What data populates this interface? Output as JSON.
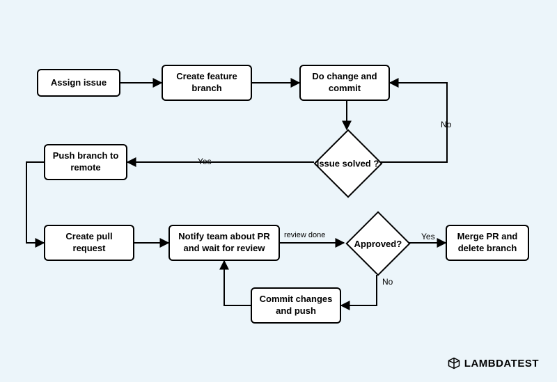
{
  "nodes": {
    "assign": "Assign issue",
    "create_branch": "Create feature branch",
    "do_change": "Do change and commit",
    "issue_solved": "Issue solved ?",
    "push": "Push branch to remote",
    "create_pr": "Create pull request",
    "notify": "Notify team about PR and wait for review",
    "approved": "Approved?",
    "merge": "Merge PR and delete branch",
    "commit_push": "Commit changes and push"
  },
  "edges": {
    "no1": "No",
    "yes1": "Yes",
    "review_done": "review done",
    "yes2": "Yes",
    "no2": "No"
  },
  "brand": "LAMBDATEST",
  "chart_data": {
    "type": "flowchart",
    "nodes": [
      {
        "id": "assign",
        "label": "Assign issue",
        "shape": "rect"
      },
      {
        "id": "create_branch",
        "label": "Create feature branch",
        "shape": "rect"
      },
      {
        "id": "do_change",
        "label": "Do change and commit",
        "shape": "rect"
      },
      {
        "id": "issue_solved",
        "label": "Issue solved ?",
        "shape": "diamond"
      },
      {
        "id": "push",
        "label": "Push branch to remote",
        "shape": "rect"
      },
      {
        "id": "create_pr",
        "label": "Create pull request",
        "shape": "rect"
      },
      {
        "id": "notify",
        "label": "Notify team about PR and wait for review",
        "shape": "rect"
      },
      {
        "id": "approved",
        "label": "Approved?",
        "shape": "diamond"
      },
      {
        "id": "merge",
        "label": "Merge PR and delete branch",
        "shape": "rect"
      },
      {
        "id": "commit_push",
        "label": "Commit changes and push",
        "shape": "rect"
      }
    ],
    "edges": [
      {
        "from": "assign",
        "to": "create_branch"
      },
      {
        "from": "create_branch",
        "to": "do_change"
      },
      {
        "from": "do_change",
        "to": "issue_solved"
      },
      {
        "from": "issue_solved",
        "to": "do_change",
        "label": "No"
      },
      {
        "from": "issue_solved",
        "to": "push",
        "label": "Yes"
      },
      {
        "from": "push",
        "to": "create_pr"
      },
      {
        "from": "create_pr",
        "to": "notify"
      },
      {
        "from": "notify",
        "to": "approved",
        "label": "review done"
      },
      {
        "from": "approved",
        "to": "merge",
        "label": "Yes"
      },
      {
        "from": "approved",
        "to": "commit_push",
        "label": "No"
      },
      {
        "from": "commit_push",
        "to": "notify"
      }
    ]
  }
}
